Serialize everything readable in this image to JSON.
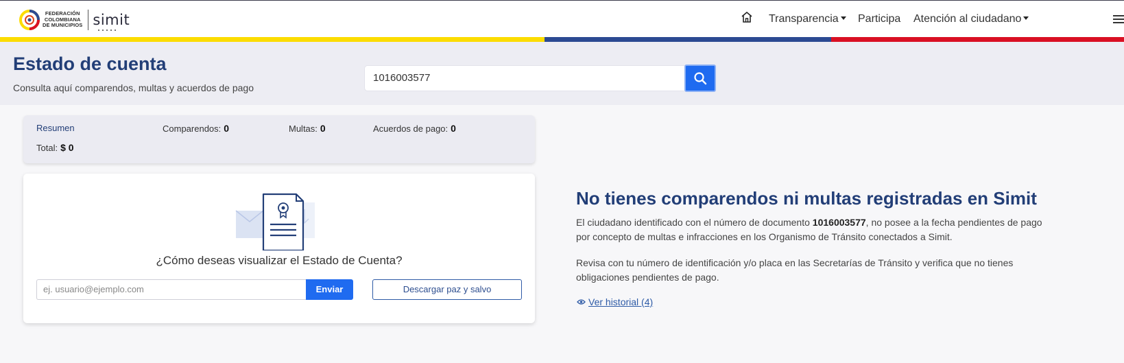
{
  "header": {
    "logo": {
      "org_line1": "FEDERACIÓN",
      "org_line2": "COLOMBIANA",
      "org_line3": "DE MUNICIPIOS",
      "brand": "simit"
    },
    "nav": {
      "home_icon": "home-icon",
      "transparencia": "Transparencia",
      "participa": "Participa",
      "atencion": "Atención al ciudadano",
      "menu_icon": "hamburger-icon"
    },
    "stripe_colors": [
      "#fcdc00",
      "#2c4a92",
      "#d91023"
    ]
  },
  "hero": {
    "title": "Estado de cuenta",
    "subtitle": "Consulta aquí comparendos, multas y acuerdos de pago",
    "search_value": "1016003577",
    "search_icon": "search-icon"
  },
  "summary": {
    "title": "Resumen",
    "comparendos_label": "Comparendos:",
    "comparendos_value": "0",
    "multas_label": "Multas:",
    "multas_value": "0",
    "acuerdos_label": "Acuerdos de pago:",
    "acuerdos_value": "0",
    "total_label": "Total:",
    "total_value": "$ 0"
  },
  "visualize": {
    "question": "¿Cómo deseas visualizar el Estado de Cuenta?",
    "email_placeholder": "ej. usuario@ejemplo.com",
    "send_label": "Enviar",
    "download_label": "Descargar paz y salvo"
  },
  "result": {
    "title": "No tienes comparendos ni multas registradas en Simit",
    "p1_before": "El ciudadano identificado con el número de documento ",
    "p1_doc": "1016003577",
    "p1_after": ", no posee a la fecha pendientes de pago por concepto de multas e infracciones en los Organismo de Tránsito conectados a Simit.",
    "p2": "Revisa con tu número de identificación y/o placa en las Secretarías de Tránsito y verifica que no tienes obligaciones pendientes de pago.",
    "history_link": "Ver historial (4)",
    "history_icon": "eye-icon"
  },
  "colors": {
    "primary_blue": "#1f6bf0",
    "title_navy": "#223e77"
  }
}
